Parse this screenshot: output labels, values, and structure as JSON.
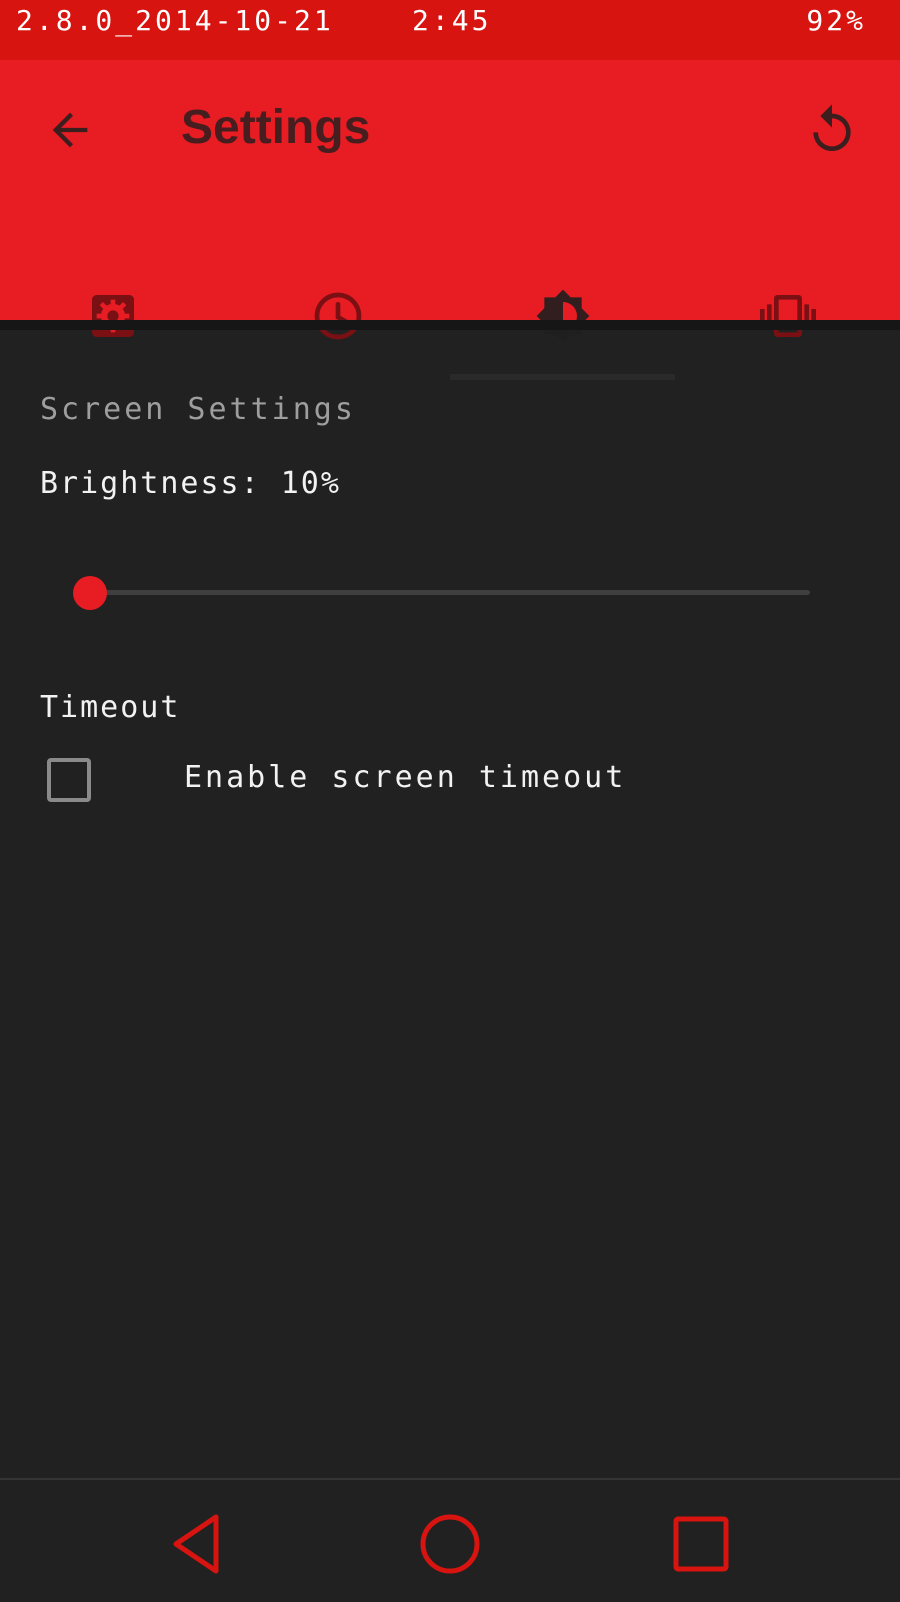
{
  "status_bar": {
    "left_text": "2.8.0_2014-10-21",
    "time": "2:45",
    "battery": "92%"
  },
  "app_bar": {
    "title": "Settings",
    "back_icon": "arrow-back-icon",
    "reset_icon": "reset-icon"
  },
  "tabs": [
    {
      "icon": "gear-icon",
      "active": false
    },
    {
      "icon": "clock-icon",
      "active": false
    },
    {
      "icon": "brightness-icon",
      "active": true
    },
    {
      "icon": "vibration-icon",
      "active": false
    }
  ],
  "screen_settings": {
    "header": "Screen Settings",
    "brightness_label": "Brightness: 10%",
    "brightness_value": 0,
    "timeout_label": "Timeout",
    "timeout_checkbox_label": "Enable screen timeout",
    "timeout_checked": false
  },
  "colors": {
    "accent": "#e81c23",
    "status_bar": "#d7140f",
    "background": "#212121"
  },
  "nav_bar": [
    "nav-back-icon",
    "nav-home-icon",
    "nav-recents-icon"
  ]
}
